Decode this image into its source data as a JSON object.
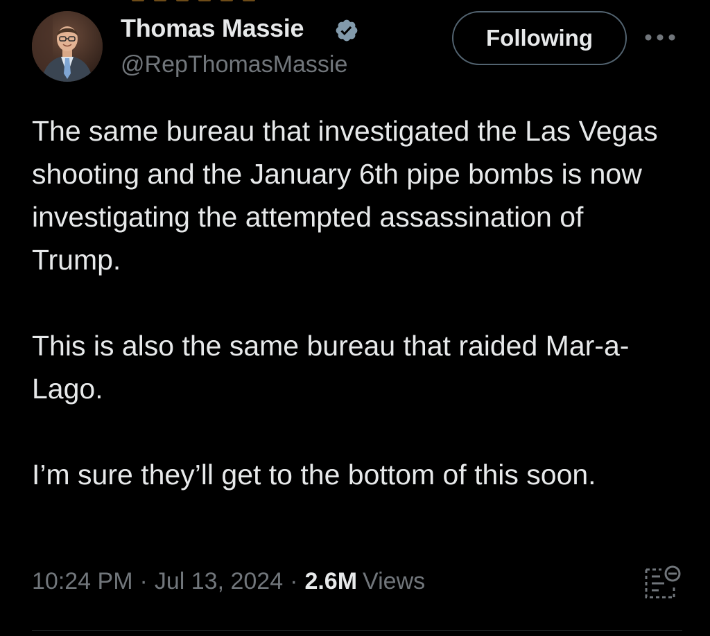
{
  "author": {
    "name": "Thomas Massie",
    "handle": "@RepThomasMassie",
    "verified": true,
    "verified_badge_color": "#829aab"
  },
  "header": {
    "follow_label": "Following",
    "more_icon": "more-horizontal-icon"
  },
  "tweet": {
    "paragraphs": [
      "The same bureau that investigated the Las Vegas shooting and the January 6th pipe bombs is now investigating the attempted assassination of Trump.",
      "This is also the same bureau that raided Mar-a-Lago.",
      "I’m sure they’ll get to the bottom of this soon."
    ]
  },
  "meta": {
    "time": "10:24 PM",
    "separator": "·",
    "date": "Jul 13, 2024",
    "views_count": "2.6M",
    "views_label": "Views",
    "analytics_icon": "analytics-icon"
  },
  "colors": {
    "background": "#000000",
    "primary_text": "#e7e9ea",
    "secondary_text": "#71767b",
    "border": "#536471"
  }
}
